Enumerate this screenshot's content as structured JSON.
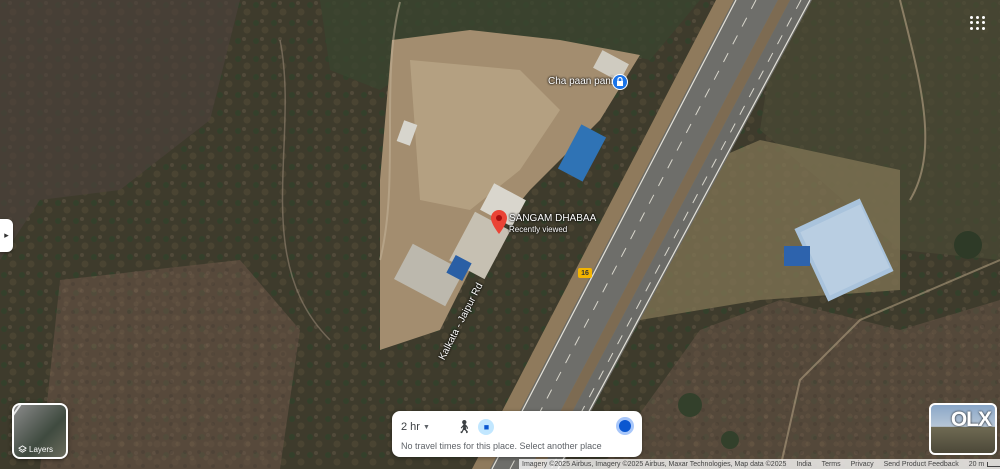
{
  "places": {
    "primary": {
      "name": "SANGAM DHABAA",
      "subtitle": "Recently viewed",
      "pin_color": "#ea4335"
    },
    "secondary": {
      "name": "Cha paan pani",
      "pin_color": "#1a73e8"
    }
  },
  "road": {
    "name": "Kalkata - Jaipur Rd",
    "route_shield": "16"
  },
  "layers_button": {
    "label": "Layers",
    "icon": "layers-icon"
  },
  "apps_button": {
    "icon": "apps-grid-icon"
  },
  "travel_panel": {
    "time_selected": "2 hr",
    "modes": [
      "walking-icon",
      "car-icon"
    ],
    "message": "No travel times for this place. Select another place"
  },
  "thumbnail": {
    "watermark": "OLX"
  },
  "attribution": {
    "imagery": "Imagery ©2025 Airbus, Imagery ©2025 Airbus, Maxar Technologies, Map data ©2025",
    "links": [
      "India",
      "Terms",
      "Privacy",
      "Send Product Feedback"
    ],
    "scale": "20 m"
  },
  "colors": {
    "accent": "#0b57d0",
    "route_shield": "#f4b400"
  }
}
